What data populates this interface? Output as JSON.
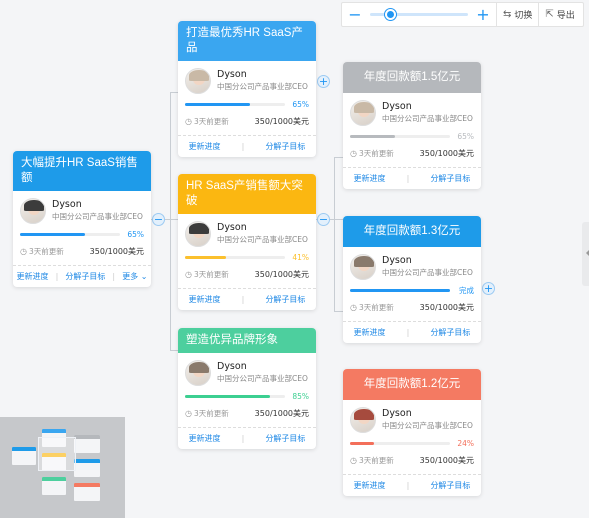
{
  "toolbar": {
    "zoom_out": "−",
    "zoom_in": "+",
    "zoom_level": 0.2,
    "switch_icon": "⇆",
    "switch_label": "切换",
    "export_icon": "⇱",
    "export_label": "导出"
  },
  "cards": {
    "root": {
      "title": "大幅提升HR SaaS销售额",
      "color": "#1e9be9",
      "owner": "Dyson",
      "owner_title": "中国分公司产品事业部CEO",
      "progress": 65,
      "progress_label": "65%",
      "progress_color": "#2196f3",
      "updated": "3天前更新",
      "budget": "350/1000美元",
      "action_update": "更新进度",
      "action_split": "分解子目标",
      "action_more": "更多",
      "more_icon": "⌄"
    },
    "goal1": {
      "title": "打造最优秀HR SaaS产品",
      "color": "#3aa6f0",
      "owner": "Dyson",
      "owner_title": "中国分公司产品事业部CEO",
      "progress": 65,
      "progress_label": "65%",
      "progress_color": "#2196f3",
      "updated": "3天前更新",
      "budget": "350/1000美元",
      "action_update": "更新进度",
      "action_split": "分解子目标"
    },
    "goal2": {
      "title": "HR SaaS产销售额大突破",
      "color": "#fbb711",
      "owner": "Dyson",
      "owner_title": "中国分公司产品事业部CEO",
      "progress": 41,
      "progress_label": "41%",
      "progress_color": "#fbc02d",
      "updated": "3天前更新",
      "budget": "350/1000美元",
      "action_update": "更新进度",
      "action_split": "分解子目标"
    },
    "goal3": {
      "title": "塑造优异品牌形象",
      "color": "#4dcf9e",
      "owner": "Dyson",
      "owner_title": "中国分公司产品事业部CEO",
      "progress": 85,
      "progress_label": "85%",
      "progress_color": "#3ccf91",
      "updated": "3天前更新",
      "budget": "350/1000美元",
      "action_update": "更新进度",
      "action_split": "分解子目标"
    },
    "sub1": {
      "title": "年度回款额1.5亿元",
      "color": "#b5b8bc",
      "owner": "Dyson",
      "owner_title": "中国分公司产品事业部CEO",
      "progress": 45,
      "progress_label": "65%",
      "progress_color": "#b7babe",
      "updated": "3天前更新",
      "budget": "350/1000美元",
      "action_update": "更新进度",
      "action_split": "分解子目标"
    },
    "sub2": {
      "title": "年度回款额1.3亿元",
      "color": "#1e9be9",
      "owner": "Dyson",
      "owner_title": "中国分公司产品事业部CEO",
      "progress": 100,
      "progress_label": "完成",
      "progress_color": "#2196f3",
      "updated": "3天前更新",
      "budget": "350/1000美元",
      "action_update": "更新进度",
      "action_split": "分解子目标"
    },
    "sub3": {
      "title": "年度回款额1.2亿元",
      "color": "#f47a62",
      "owner": "Dyson",
      "owner_title": "中国分公司产品事业部CEO",
      "progress": 24,
      "progress_label": "24%",
      "progress_color": "#f36f5a",
      "updated": "3天前更新",
      "budget": "350/1000美元",
      "action_update": "更新进度",
      "action_split": "分解子目标"
    }
  },
  "connectors": {
    "expand_icon": "+",
    "collapse_icon": "−"
  },
  "icons": {
    "clock": "◷"
  }
}
